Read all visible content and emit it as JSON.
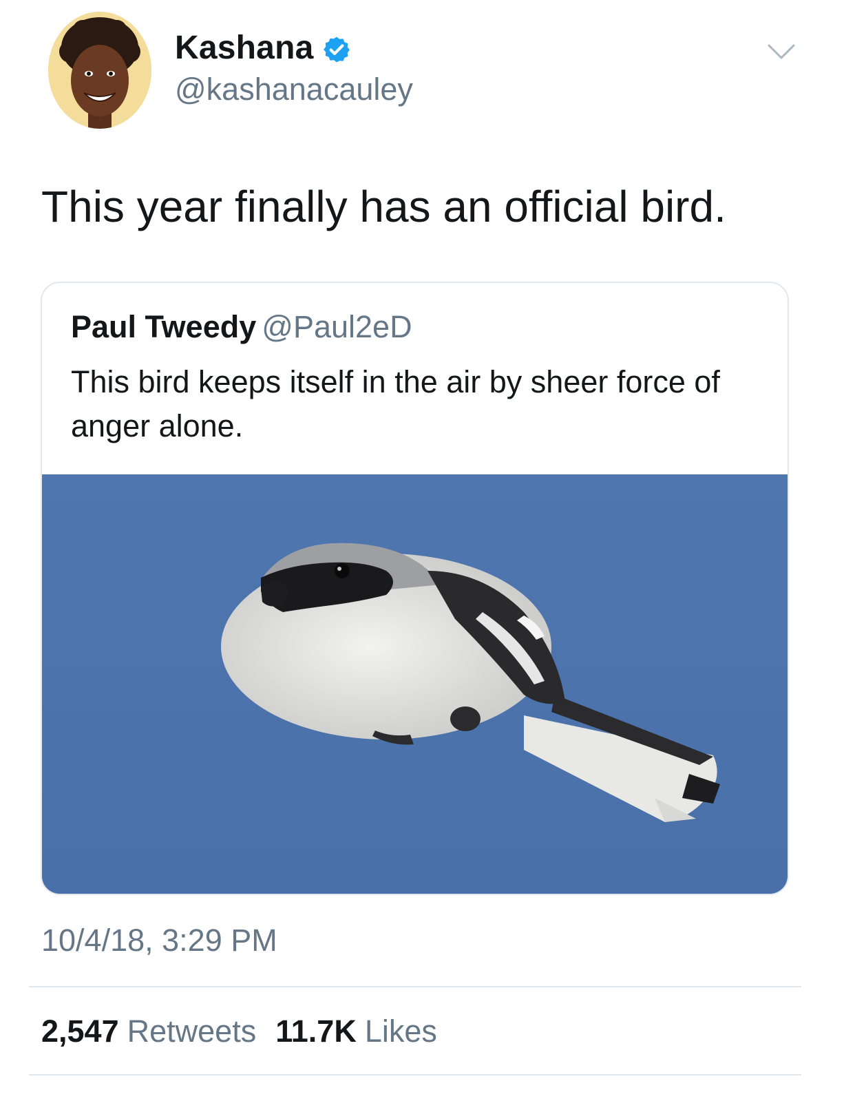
{
  "author": {
    "display_name": "Kashana",
    "handle": "@kashanacauley",
    "verified": true
  },
  "tweet": {
    "text": "This year finally has an official bird.",
    "timestamp": "10/4/18, 3:29 PM"
  },
  "quoted_tweet": {
    "display_name": "Paul Tweedy",
    "handle": "@Paul2eD",
    "text": "This bird keeps itself in the air by sheer force of anger alone."
  },
  "stats": {
    "retweets_count": "2,547",
    "retweets_label": "Retweets",
    "likes_count": "11.7K",
    "likes_label": "Likes"
  },
  "colors": {
    "text_primary": "#14171a",
    "text_secondary": "#657786",
    "verified_blue": "#1da1f2",
    "border": "#e1e8ed",
    "sky_blue": "#4d74ad"
  },
  "icons": {
    "verified": "verified-badge-icon",
    "caret": "chevron-down-icon"
  }
}
